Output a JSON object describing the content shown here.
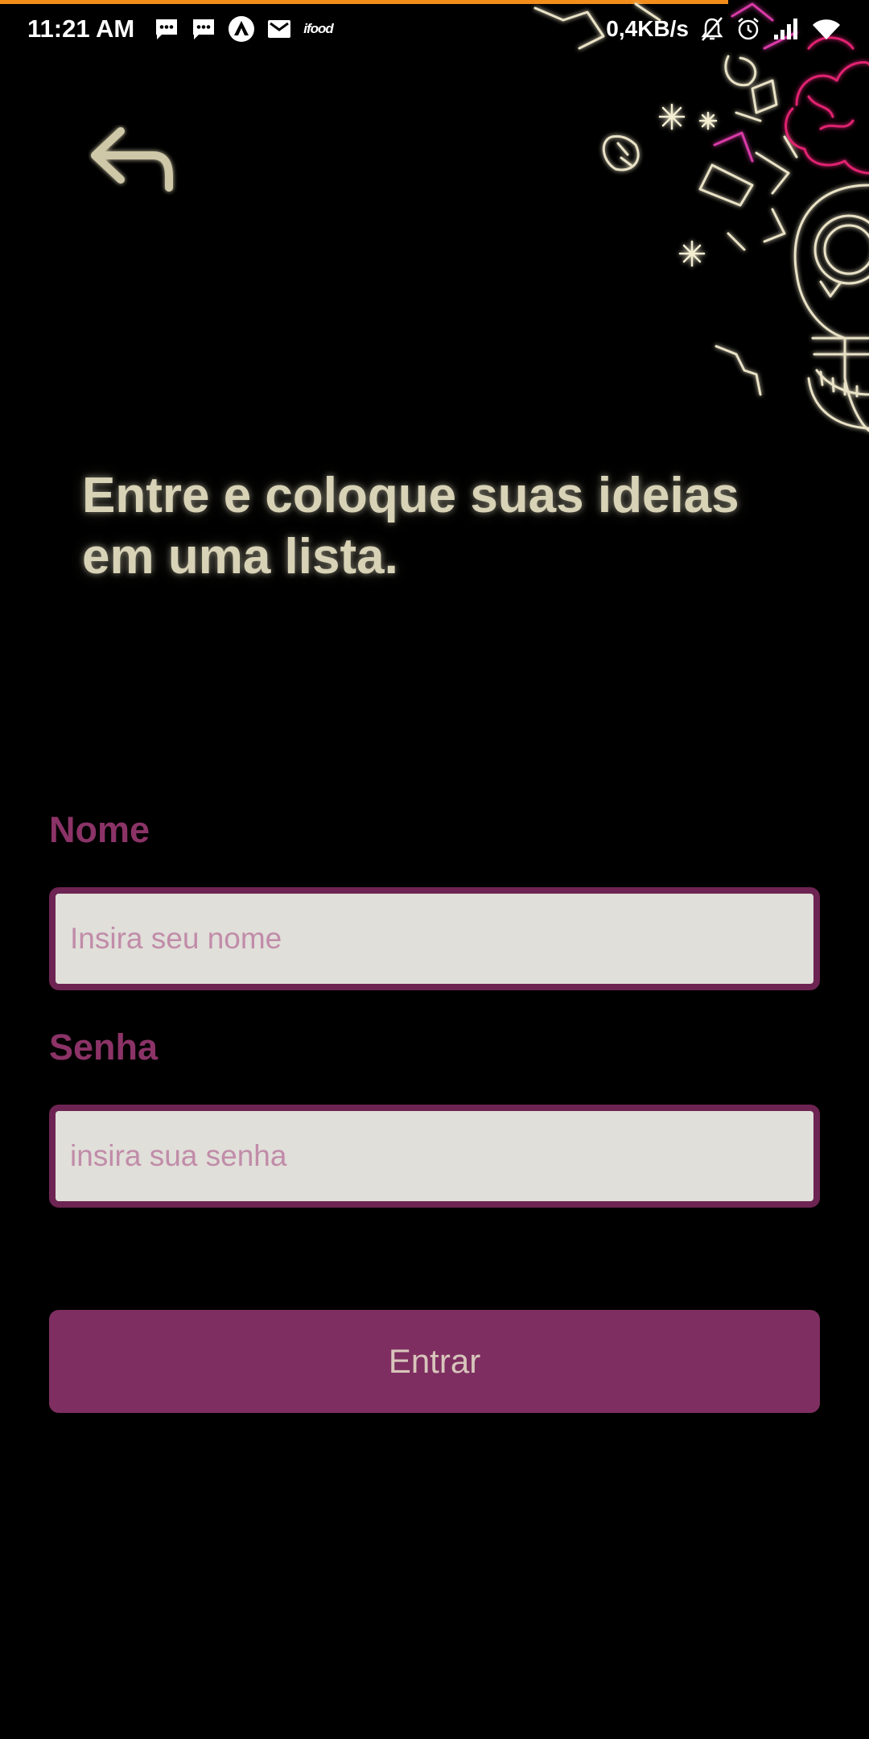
{
  "status_bar": {
    "time": "11:21 AM",
    "notification_icons": [
      "message-icon",
      "message-icon",
      "drive-icon",
      "gmail-icon",
      "ifood-icon"
    ],
    "ifood_label": "ifood",
    "network_speed": "0,4KB/s",
    "system_icons": [
      "notifications-off-icon",
      "alarm-icon",
      "signal-icon",
      "wifi-icon"
    ]
  },
  "colors": {
    "background": "#000000",
    "accent": "#7e2e61",
    "label": "#8b3367",
    "headline": "#d8d3b7",
    "field_bg": "#e0dfd9",
    "progress": "#f28c1b"
  },
  "back": {
    "icon": "reply-arrow-icon"
  },
  "headline": "Entre e coloque suas ideias em uma lista.",
  "form": {
    "name": {
      "label": "Nome",
      "placeholder": "Insira seu nome",
      "value": ""
    },
    "password": {
      "label": "Senha",
      "placeholder": "insira sua senha",
      "value": ""
    },
    "submit_label": "Entrar"
  }
}
